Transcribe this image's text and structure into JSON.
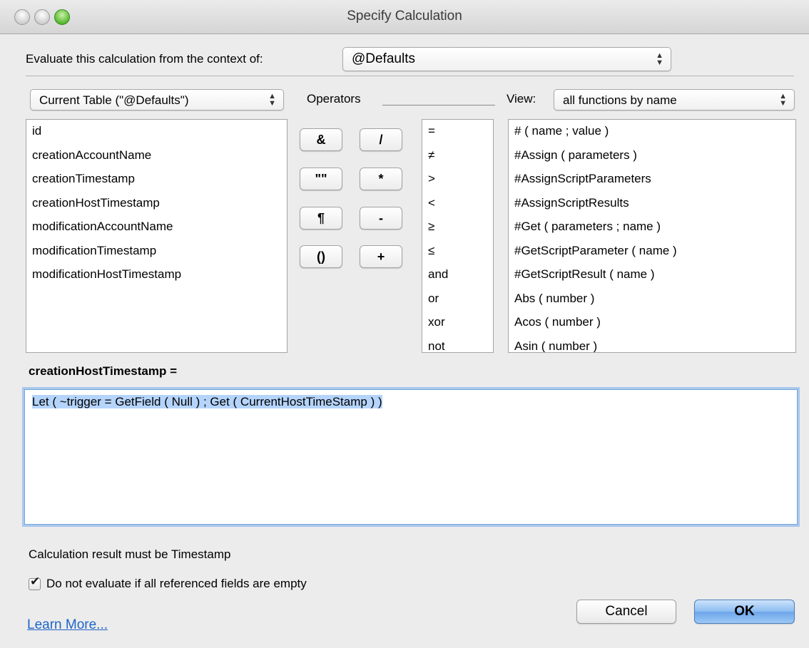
{
  "window": {
    "title": "Specify Calculation"
  },
  "context": {
    "label": "Evaluate this calculation from the context of:",
    "value": "@Defaults"
  },
  "table_popup": {
    "value": "Current Table (\"@Defaults\")"
  },
  "operators": {
    "label": "Operators",
    "buttons": [
      "&",
      "/",
      "\"\"",
      "*",
      "¶",
      "-",
      "()",
      "+"
    ],
    "list": [
      "=",
      "≠",
      ">",
      "<",
      "≥",
      "≤",
      "and",
      "or",
      "xor",
      "not"
    ]
  },
  "view": {
    "label": "View:",
    "value": "all functions by name"
  },
  "fields": [
    "id",
    "creationAccountName",
    "creationTimestamp",
    "creationHostTimestamp",
    "modificationAccountName",
    "modificationTimestamp",
    "modificationHostTimestamp"
  ],
  "functions": [
    "# ( name ; value )",
    "#Assign ( parameters )",
    "#AssignScriptParameters",
    "#AssignScriptResults",
    "#Get ( parameters ; name )",
    "#GetScriptParameter ( name )",
    "#GetScriptResult ( name )",
    "Abs ( number )",
    "Acos ( number )",
    "Asin ( number )"
  ],
  "calculation": {
    "field_label": "creationHostTimestamp =",
    "formula": "Let ( ~trigger = GetField ( Null ) ; Get ( CurrentHostTimeStamp ) )"
  },
  "result_type": "Calculation result must be Timestamp",
  "checkbox": {
    "label": "Do not evaluate if all referenced fields are empty",
    "checked": true
  },
  "links": {
    "learn_more": "Learn More..."
  },
  "buttons": {
    "cancel": "Cancel",
    "ok": "OK"
  }
}
